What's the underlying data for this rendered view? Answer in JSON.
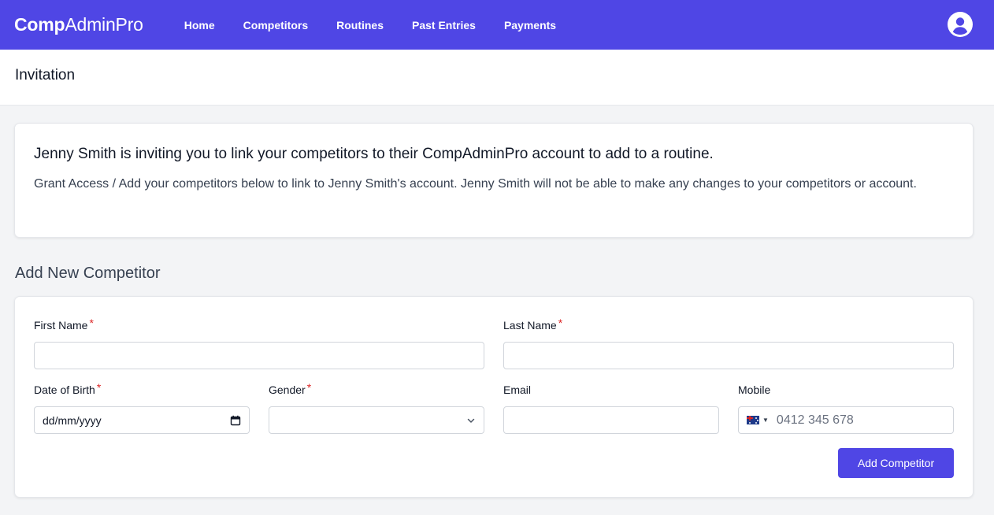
{
  "nav": {
    "brand_bold": "Comp",
    "brand_rest": "AdminPro",
    "links": [
      "Home",
      "Competitors",
      "Routines",
      "Past Entries",
      "Payments"
    ],
    "avatar_icon": "user-circle-icon"
  },
  "page": {
    "title": "Invitation"
  },
  "invite": {
    "heading": "Jenny Smith is inviting you to link your competitors to their CompAdminPro account to add to a routine.",
    "body": "Grant Access / Add your competitors below to link to Jenny Smith's account. Jenny Smith will not be able to make any changes to your competitors or account."
  },
  "form": {
    "section_title": "Add New Competitor",
    "first_name_label": "First Name",
    "last_name_label": "Last Name",
    "dob_label": "Date of Birth",
    "dob_placeholder": "dd/mm/yyyy",
    "gender_label": "Gender",
    "email_label": "Email",
    "mobile_label": "Mobile",
    "mobile_placeholder": "0412 345 678",
    "required_marker": "*",
    "submit_label": "Add Competitor"
  },
  "colors": {
    "primary": "#4f46e5",
    "required": "#dc2626",
    "background": "#f3f4f6"
  }
}
